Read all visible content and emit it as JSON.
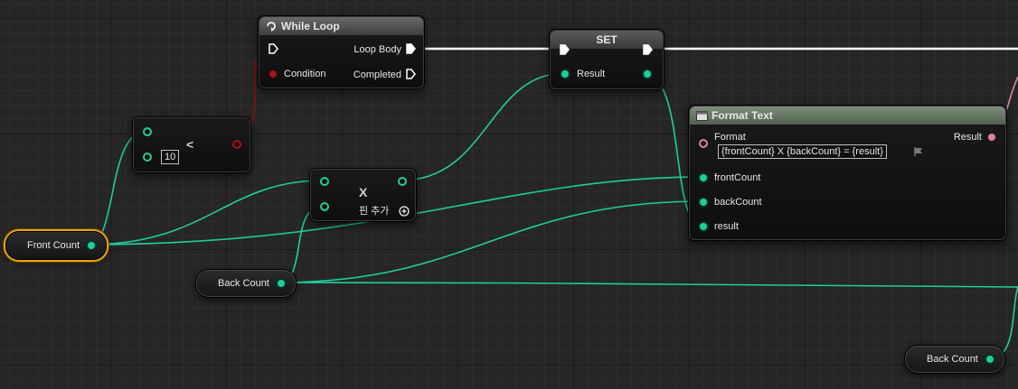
{
  "while_loop": {
    "title": "While Loop",
    "loop_body_label": "Loop Body",
    "condition_label": "Condition",
    "completed_label": "Completed"
  },
  "set_node": {
    "title": "SET",
    "result_label": "Result"
  },
  "less_node": {
    "operator": "<",
    "b_value": "10"
  },
  "multiply_node": {
    "operator": "X",
    "add_pin_label": "핀 추가"
  },
  "format_text": {
    "title": "Format Text",
    "format_label": "Format",
    "format_value": "{frontCount} X {backCount} = {result}",
    "result_label": "Result",
    "pins": [
      "frontCount",
      "backCount",
      "result"
    ]
  },
  "variables": {
    "front_count": "Front Count",
    "back_count_1": "Back Count",
    "back_count_2": "Back Count"
  },
  "colors": {
    "integer_pin": "#1ecf9c",
    "exec_wire": "#ffffff",
    "bool_pin": "#a01818",
    "text_pin": "#e080a8",
    "selection": "#e8a317"
  }
}
